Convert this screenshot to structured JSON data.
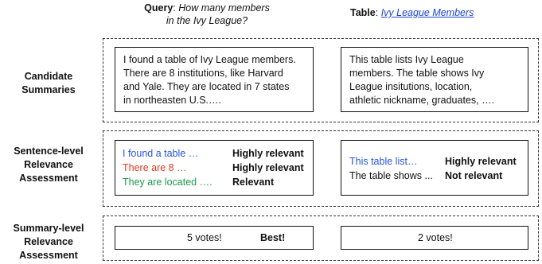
{
  "header": {
    "query_label": "Query",
    "query_text_line1": "How many members",
    "query_text_line2": "in the Ivy League?",
    "table_label": "Table",
    "table_link": "Ivy League Members"
  },
  "rows": {
    "candidate": {
      "line1": "Candidate",
      "line2": "Summaries"
    },
    "sentence": {
      "line1": "Sentence-level",
      "line2": "Relevance",
      "line3": "Assessment"
    },
    "summary": {
      "line1": "Summary-level",
      "line2": "Relevance",
      "line3": "Assessment"
    }
  },
  "summaries": {
    "left": [
      "I found a table of Ivy League members.",
      "There are 8 institutions, like Harvard",
      "and Yale. They are located in 7 states",
      "in northeasten U.S.…."
    ],
    "right": [
      "This table lists Ivy League",
      "members.  The table shows Ivy",
      "League insitutions, location,",
      "athletic nickname, graduates, …."
    ]
  },
  "sentence_assessment": {
    "left": [
      {
        "text": "I found a table …",
        "label": "Highly relevant",
        "color": "#2a55d9"
      },
      {
        "text": "There are 8 …",
        "label": "Highly relevant",
        "color": "#e0391f"
      },
      {
        "text": "They are located ….",
        "label": "Relevant",
        "color": "#1c9a4c"
      }
    ],
    "right": [
      {
        "text": "This table list…",
        "label": "Highly relevant",
        "color": "#2a55d9"
      },
      {
        "text": "The table shows ...",
        "label": "Not relevant",
        "color": "#111111"
      }
    ]
  },
  "summary_assessment": {
    "left_votes": "5 votes!",
    "left_badge": "Best!",
    "right_votes": "2 votes!"
  }
}
